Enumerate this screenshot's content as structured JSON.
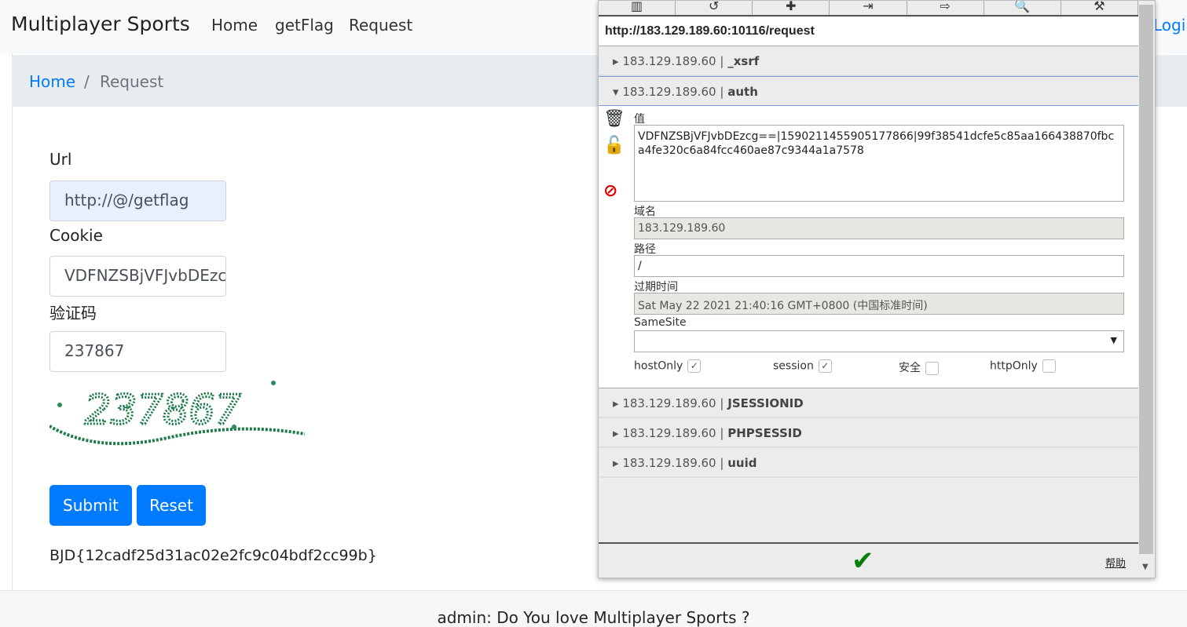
{
  "nav": {
    "brand": "Multiplayer Sports",
    "links": [
      "Home",
      "getFlag",
      "Request"
    ],
    "login": "Login"
  },
  "breadcrumb": {
    "home": "Home",
    "sep": "/",
    "current": "Request"
  },
  "form": {
    "url_label": "Url",
    "url_value": "http://@/getflag",
    "cookie_label": "Cookie",
    "cookie_value": "VDFNZSBjVFJvbDEzcg==",
    "captcha_label": "验证码",
    "captcha_value": "237867",
    "captcha_image_text": "237867",
    "submit": "Submit",
    "reset": "Reset"
  },
  "flag": "BJD{12cadf25d31ac02e2fc9c04bdf2cc99b}",
  "footer": "admin: Do You love Multiplayer Sports ?",
  "cookie_editor": {
    "toolbar_icons": [
      "trash-icon",
      "undo-icon",
      "add-icon",
      "import-icon",
      "export-icon",
      "search-icon",
      "tools-icon"
    ],
    "url": "http://183.129.189.60:10116/request",
    "cookies": [
      {
        "domain": "183.129.189.60",
        "sep": "|",
        "name": "_xsrf"
      },
      {
        "domain": "183.129.189.60",
        "sep": "|",
        "name": "auth"
      },
      {
        "domain": "183.129.189.60",
        "sep": "|",
        "name": "JSESSIONID"
      },
      {
        "domain": "183.129.189.60",
        "sep": "|",
        "name": "PHPSESSID"
      },
      {
        "domain": "183.129.189.60",
        "sep": "|",
        "name": "uuid"
      }
    ],
    "detail": {
      "value_label": "值",
      "value": "VDFNZSBjVFJvbDEzcg==|1590211455905177866|99f38541dcfe5c85aa166438870fbca4fe320c6a84fcc460ae87c9344a1a7578",
      "domain_label": "域名",
      "domain": "183.129.189.60",
      "path_label": "路径",
      "path": "/",
      "expires_label": "过期时间",
      "expires": "Sat May 22 2021 21:40:16 GMT+0800 (中国标准时间)",
      "samesite_label": "SameSite",
      "samesite": "",
      "hostonly": "hostOnly",
      "session": "session",
      "secure": "安全",
      "httponly": "httpOnly"
    },
    "help": "帮助"
  }
}
